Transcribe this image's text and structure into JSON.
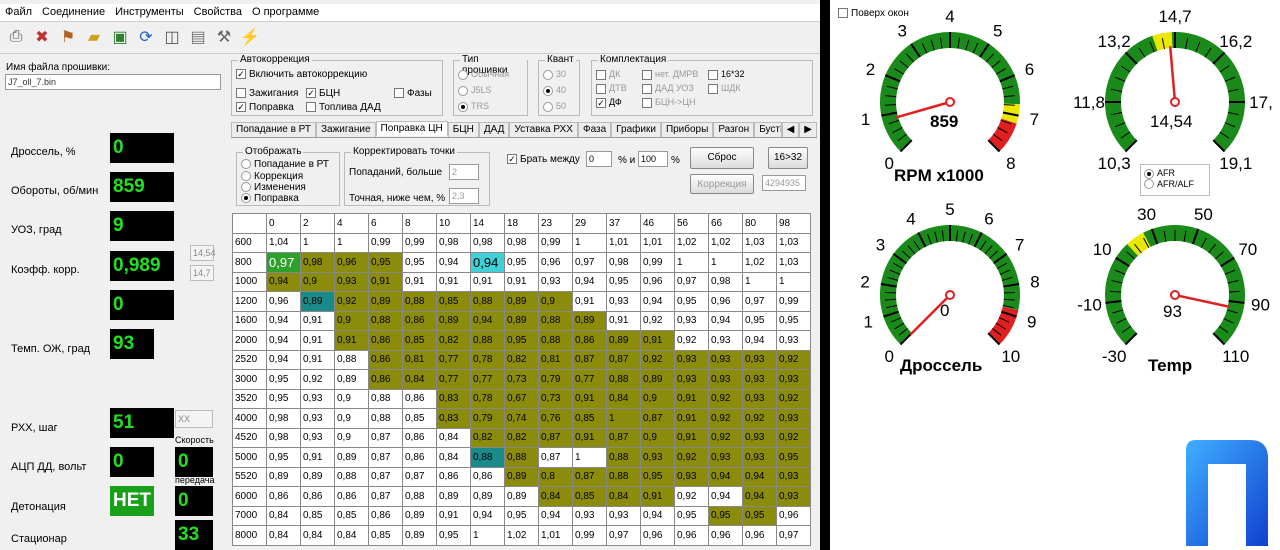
{
  "menu": [
    "Файл",
    "Соединение",
    "Инструменты",
    "Свойства",
    "О программе"
  ],
  "toolbar": [
    "printer-icon",
    "disconnect-icon",
    "plugin-icon",
    "open-folder-icon",
    "save-chip-icon",
    "refresh-icon",
    "chip-icon",
    "clipboard-icon",
    "tools-icon",
    "flash-icon"
  ],
  "sidebar": {
    "file_label": "Имя файла прошивки:",
    "file_value": "J7_oll_7.bin",
    "rows": [
      {
        "label": "Дроссель, %",
        "value": "0"
      },
      {
        "label": "Обороты, об/мин",
        "value": "859"
      },
      {
        "label": "УОЗ, град",
        "value": "9"
      },
      {
        "label": "Коэфф. корр.",
        "value": "0,989"
      },
      {
        "label": "",
        "value": "0"
      },
      {
        "label": "Темп. ОЖ, град",
        "value": "93"
      },
      {
        "label": "РХХ, шаг",
        "value": "51"
      },
      {
        "label": "АЦП ДД, вольт",
        "value": "0"
      },
      {
        "label": "Детонация",
        "value": "НЕТ"
      },
      {
        "label": "Стационар",
        "value": ""
      }
    ],
    "afr1": "14,54",
    "afr2": "14,7",
    "xx": "XX",
    "speed_label": "Скорость",
    "speed_value": "0",
    "gear_label": "передача",
    "gear_value": "0",
    "extra_value": "33"
  },
  "autocorr": {
    "title": "Автокоррекция",
    "enable": "Включить автокоррекцию",
    "ign": "Зажигания",
    "bcn": "БЦН",
    "phase": "Фазы",
    "fix": "Поправка",
    "fuel": "Топлива ДАД"
  },
  "fw": {
    "title": "Тип прошивки",
    "o": [
      "Обычная",
      "J5LS",
      "TRS"
    ]
  },
  "kvant": {
    "title": "Квант",
    "o": [
      "30",
      "40",
      "50"
    ]
  },
  "kompl": {
    "title": "Комплектация",
    "o": [
      "ДК",
      "нет. ДМРВ",
      "16*32",
      "ДТВ",
      "ДАД УОЗ",
      "ШДК",
      "ДФ",
      "БЦН->ЦН"
    ]
  },
  "tabs": [
    "Попадание в РТ",
    "Зажигание",
    "Поправка ЦН",
    "БЦН",
    "ДАД",
    "Уставка РХХ",
    "Фаза",
    "Графики",
    "Приборы",
    "Разгон",
    "БустКонтрол"
  ],
  "display": {
    "title": "Отображать",
    "o": [
      "Попадание в РТ",
      "Коррекция",
      "Изменения",
      "Поправка"
    ]
  },
  "corr": {
    "title": "Корректировать точки",
    "hits": "Попаданий, больше",
    "hits_v": "2",
    "acc": "Точная, ниже чем, %",
    "acc_v": "2,3"
  },
  "between": {
    "label": "Брать между",
    "a": "0",
    "and": "% и",
    "b": "100",
    "pct": "%"
  },
  "buttons": {
    "reset": "Сброс",
    "b1632": "16>32",
    "correction": "Коррекция",
    "num": "4294935"
  },
  "grid": {
    "cols": [
      "0",
      "2",
      "4",
      "6",
      "8",
      "10",
      "14",
      "18",
      "23",
      "29",
      "37",
      "46",
      "56",
      "66",
      "80",
      "98"
    ],
    "rows": [
      {
        "r": "600",
        "v": [
          "1,04",
          "1",
          "1",
          "0,99",
          "0,99",
          "0,98",
          "0,98",
          "0,98",
          "0,99",
          "1",
          "1,01",
          "1,01",
          "1,02",
          "1,02",
          "1,03",
          "1,03"
        ],
        "c": "................"
      },
      {
        "r": "800",
        "v": [
          "0,97",
          "0,98",
          "0,96",
          "0,95",
          "0,95",
          "0,94",
          "0,94",
          "0,95",
          "0,96",
          "0,97",
          "0,98",
          "0,99",
          "1",
          "1",
          "1,02",
          "1,03"
        ],
        "c": "GOOO..C........."
      },
      {
        "r": "1000",
        "v": [
          "0,94",
          "0,9",
          "0,93",
          "0,91",
          "0,91",
          "0,91",
          "0,91",
          "0,91",
          "0,93",
          "0,94",
          "0,95",
          "0,96",
          "0,97",
          "0,98",
          "1",
          "1"
        ],
        "c": "OOOO............"
      },
      {
        "r": "1200",
        "v": [
          "0,96",
          "0,89",
          "0,92",
          "0,89",
          "0,88",
          "0,85",
          "0,88",
          "0,89",
          "0,9",
          "0,91",
          "0,93",
          "0,94",
          "0,95",
          "0,96",
          "0,97",
          "0,99"
        ],
        "c": ".TOOOOOOO......."
      },
      {
        "r": "1600",
        "v": [
          "0,94",
          "0,91",
          "0,9",
          "0,88",
          "0,86",
          "0,89",
          "0,94",
          "0,89",
          "0,88",
          "0,89",
          "0,91",
          "0,92",
          "0,93",
          "0,94",
          "0,95",
          "0,95"
        ],
        "c": "..OOOOOOOO......"
      },
      {
        "r": "2000",
        "v": [
          "0,94",
          "0,91",
          "0,91",
          "0,86",
          "0,85",
          "0,82",
          "0,88",
          "0,95",
          "0,88",
          "0,86",
          "0,89",
          "0,91",
          "0,92",
          "0,93",
          "0,94",
          "0,93"
        ],
        "c": "..OOOOOOOOOO...."
      },
      {
        "r": "2520",
        "v": [
          "0,94",
          "0,91",
          "0,88",
          "0,86",
          "0,81",
          "0,77",
          "0,78",
          "0,82",
          "0,81",
          "0,87",
          "0,87",
          "0,92",
          "0,93",
          "0,93",
          "0,93",
          "0,92"
        ],
        "c": "...OOOOOOOOOOOOO"
      },
      {
        "r": "3000",
        "v": [
          "0,95",
          "0,92",
          "0,89",
          "0,86",
          "0,84",
          "0,77",
          "0,77",
          "0,73",
          "0,79",
          "0,77",
          "0,88",
          "0,89",
          "0,93",
          "0,93",
          "0,93",
          "0,93"
        ],
        "c": "...OOOOOOOOOOOOO"
      },
      {
        "r": "3520",
        "v": [
          "0,95",
          "0,93",
          "0,9",
          "0,88",
          "0,86",
          "0,83",
          "0,78",
          "0,67",
          "0,73",
          "0,91",
          "0,84",
          "0,9",
          "0,91",
          "0,92",
          "0,93",
          "0,92"
        ],
        "c": ".....OOOOOOOOOOO"
      },
      {
        "r": "4000",
        "v": [
          "0,98",
          "0,93",
          "0,9",
          "0,88",
          "0,85",
          "0,83",
          "0,79",
          "0,74",
          "0,76",
          "0,85",
          "1",
          "0,87",
          "0,91",
          "0,92",
          "0,92",
          "0,93"
        ],
        "c": ".....OOOOOOOOOOO"
      },
      {
        "r": "4520",
        "v": [
          "0,98",
          "0,93",
          "0,9",
          "0,87",
          "0,86",
          "0,84",
          "0,82",
          "0,82",
          "0,87",
          "0,91",
          "0,87",
          "0,9",
          "0,91",
          "0,92",
          "0,93",
          "0,92"
        ],
        "c": "......OOOOOOOOOO"
      },
      {
        "r": "5000",
        "v": [
          "0,95",
          "0,91",
          "0,89",
          "0,87",
          "0,86",
          "0,84",
          "0,88",
          "0,88",
          "0,87",
          "1",
          "0,88",
          "0,93",
          "0,92",
          "0,93",
          "0,93",
          "0,95"
        ],
        "c": "......TO..OOOOOO"
      },
      {
        "r": "5520",
        "v": [
          "0,89",
          "0,89",
          "0,88",
          "0,87",
          "0,87",
          "0,86",
          "0,86",
          "0,89",
          "0,8",
          "0,87",
          "0,88",
          "0,95",
          "0,93",
          "0,94",
          "0,94",
          "0,93"
        ],
        "c": ".......OOOOOOOOO"
      },
      {
        "r": "6000",
        "v": [
          "0,86",
          "0,86",
          "0,86",
          "0,87",
          "0,88",
          "0,89",
          "0,89",
          "0,89",
          "0,84",
          "0,85",
          "0,84",
          "0,91",
          "0,92",
          "0,94",
          "0,94",
          "0,93"
        ],
        "c": "........OOOO..OO"
      },
      {
        "r": "7000",
        "v": [
          "0,84",
          "0,85",
          "0,85",
          "0,86",
          "0,89",
          "0,91",
          "0,94",
          "0,95",
          "0,94",
          "0,93",
          "0,93",
          "0,94",
          "0,95",
          "0,95",
          "0,95",
          "0,96"
        ],
        "c": ".............OO."
      },
      {
        "r": "8000",
        "v": [
          "0,84",
          "0,84",
          "0,84",
          "0,85",
          "0,89",
          "0,95",
          "1",
          "1,02",
          "1,01",
          "0,99",
          "0,97",
          "0,96",
          "0,96",
          "0,96",
          "0,96",
          "0,97"
        ],
        "c": "................"
      }
    ]
  },
  "right": {
    "ontop": "Поверх окон",
    "rpm_label": "RPM x1000",
    "rpm_value": "859",
    "afr_value": "14,54",
    "afr_opt": [
      "AFR",
      "AFR/ALF"
    ],
    "thr_label": "Дроссель",
    "thr_value": "0",
    "temp_label": "Temp",
    "temp_value": "93"
  },
  "gauges": [
    {
      "id": "rpm",
      "min": 0,
      "max": 8,
      "value": 0.859,
      "ticks": [
        "0",
        "1",
        "2",
        "3",
        "4",
        "5",
        "6",
        "7",
        "8"
      ]
    },
    {
      "id": "afr",
      "min": 10.3,
      "max": 19.1,
      "value": 14.54,
      "ticks": [
        "10,3",
        "11,8",
        "13,2",
        "14,7",
        "16,2",
        "17,",
        "19,1"
      ]
    },
    {
      "id": "thr",
      "min": 0,
      "max": 10,
      "value": 0,
      "ticks": [
        "0",
        "1",
        "2",
        "3",
        "4",
        "5",
        "6",
        "7",
        "8",
        "9",
        "10"
      ]
    },
    {
      "id": "temp",
      "min": -30,
      "max": 110,
      "value": 93,
      "ticks": [
        "-30",
        "-10",
        "10",
        "30",
        "50",
        "70",
        "90",
        "110"
      ]
    }
  ]
}
